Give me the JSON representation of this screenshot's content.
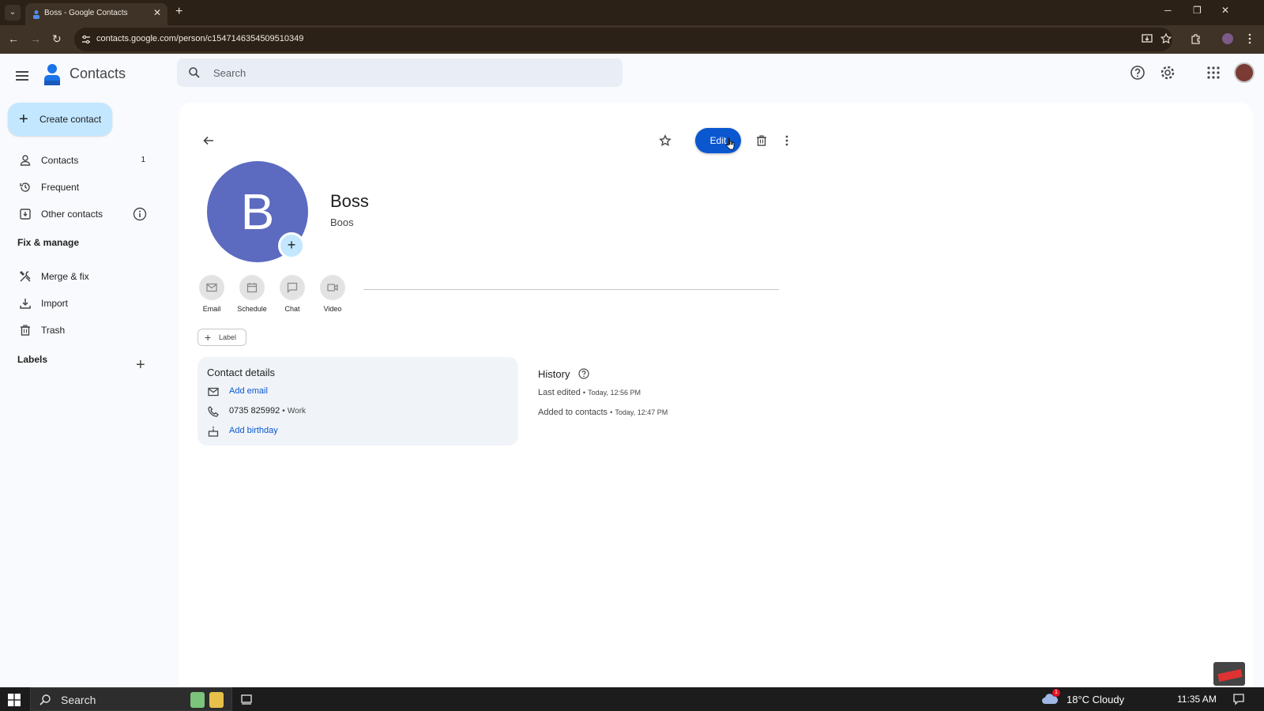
{
  "browser": {
    "tab_title": "Boss - Google Contacts",
    "url": "contacts.google.com/person/c1547146354509510349",
    "tab_close": "✕",
    "new_tab": "+",
    "win_minimize": "─",
    "win_restore": "❐",
    "win_close": "✕",
    "back": "←",
    "forward": "→",
    "reload": "↻",
    "menu_chevron": "⌄"
  },
  "header": {
    "app_name": "Contacts",
    "search_placeholder": "Search"
  },
  "sidebar": {
    "create_label": "Create contact",
    "create_plus": "+",
    "items": [
      {
        "label": "Contacts",
        "icon": "person-icon",
        "count": "1"
      },
      {
        "label": "Frequent",
        "icon": "history-icon"
      },
      {
        "label": "Other contacts",
        "icon": "inbox-download-icon"
      }
    ],
    "fix_manage_heading": "Fix & manage",
    "fix_items": [
      {
        "label": "Merge & fix",
        "icon": "tools-icon"
      },
      {
        "label": "Import",
        "icon": "download-icon"
      },
      {
        "label": "Trash",
        "icon": "trash-icon"
      }
    ],
    "labels_heading": "Labels",
    "labels_plus": "+"
  },
  "contact": {
    "initial": "B",
    "add_photo": "+",
    "name": "Boss",
    "subtitle": "Boos",
    "edit_label": "Edit",
    "actions": [
      {
        "label": "Email",
        "icon": "mail-icon"
      },
      {
        "label": "Schedule",
        "icon": "calendar-icon"
      },
      {
        "label": "Chat",
        "icon": "chat-icon"
      },
      {
        "label": "Video",
        "icon": "video-icon"
      }
    ],
    "label_chip_plus": "+",
    "label_chip": "Label",
    "details_title": "Contact details",
    "add_email": "Add email",
    "phone": "0735 825992",
    "phone_sep": "•",
    "phone_type": "Work",
    "add_birthday": "Add birthday",
    "history_title": "History",
    "last_edited_label": "Last edited",
    "last_edited_time": "Today, 12:56 PM",
    "added_label": "Added to contacts",
    "added_time": "Today, 12:47 PM",
    "history_sep": "•"
  },
  "taskbar": {
    "search": "Search",
    "weather_badge": "1",
    "weather": "18°C  Cloudy",
    "time": "11:35 AM"
  },
  "colors": {
    "accent": "#0b57d0",
    "avatar_bg": "#5c6bc0",
    "create_bg": "#c2e7ff"
  }
}
